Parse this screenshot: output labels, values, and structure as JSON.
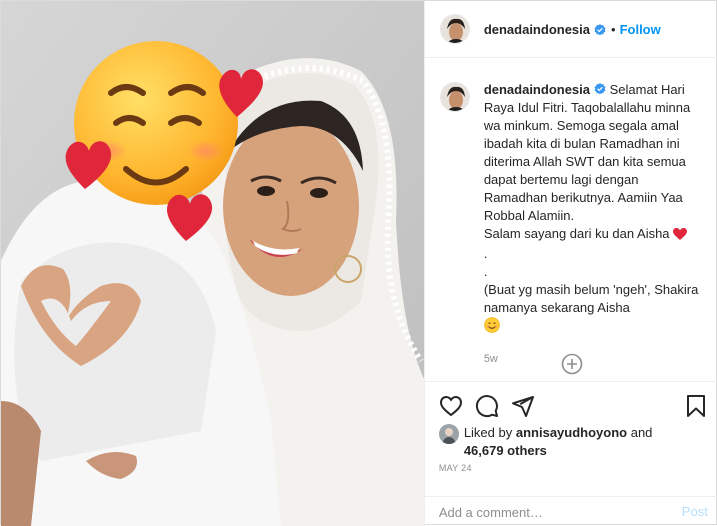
{
  "post": {
    "username": "denadaindonesia",
    "separator": "•",
    "follow_label": "Follow",
    "caption": {
      "lines": [
        "Selamat Hari Raya Idul Fitri. Taqobalallahu minna wa minkum. Semoga segala amal ibadah kita di bulan Ramadhan ini diterima Allah SWT dan kita semua dapat bertemu lagi dengan Ramadhan berikutnya. Aamiin Yaa Robbal Alamiin.",
        "Salam sayang dari ku dan Aisha",
        ".",
        ".",
        "(Buat yg masih belum 'ngeh', Shakira namanya sekarang Aisha"
      ],
      "time_ago": "5w"
    },
    "likes": {
      "prefix": "Liked by",
      "first_liker": "annisayudhoyono",
      "joiner": "and",
      "others": "46,679 others"
    },
    "date": "MAY 24",
    "comment_placeholder": "Add a comment…",
    "post_label": "Post"
  },
  "icons": {
    "verified": "verified-badge-icon",
    "more": "plus-circle-icon",
    "like": "heart-outline-icon",
    "comment": "speech-bubble-icon",
    "share": "paper-plane-icon",
    "save": "bookmark-icon",
    "emoji_face": "smiling-face-with-hearts-emoji",
    "caption_heart": "red-heart-emoji",
    "caption_smiley": "smiling-face-emoji"
  },
  "colors": {
    "link_blue": "#0095f6",
    "verified_blue": "#3897f0",
    "heart_red": "#e0263a",
    "muted_text": "#8e8e8e",
    "post_disabled": "#b2dffc"
  }
}
